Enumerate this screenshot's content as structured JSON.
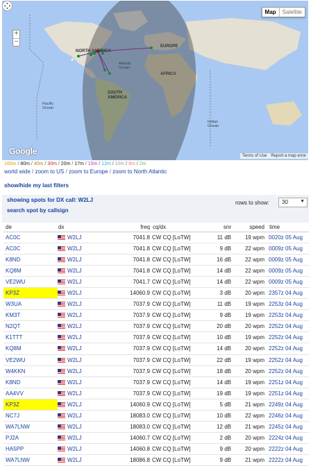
{
  "map": {
    "map_label": "Map",
    "satellite_label": "Satellite",
    "google_label": "Google",
    "terms_label": "Terms of Use",
    "report_label": "Report a map error",
    "zoom_in": "+",
    "zoom_out": "−",
    "region_labels": {
      "north_america": "NORTH\nAMERICA",
      "europe": "EUROPE",
      "africa": "AFRICA",
      "south_america": "SOUTH\nAMERICA",
      "atlantic": "Atlantic\nOcean",
      "pacific": "Pacific\nOcean",
      "indian": "Indian\nOcean"
    }
  },
  "bands": [
    {
      "label": "160m",
      "color": "#e0a000"
    },
    {
      "label": "80m",
      "color": "#222222"
    },
    {
      "label": "40m",
      "color": "#c08000"
    },
    {
      "label": "30m",
      "color": "#c03030"
    },
    {
      "label": "20m",
      "color": "#222222"
    },
    {
      "label": "17m",
      "color": "#222222"
    },
    {
      "label": "15m",
      "color": "#c030c0"
    },
    {
      "label": "12m",
      "color": "#20b0c0"
    },
    {
      "label": "10m",
      "color": "#999999"
    },
    {
      "label": "6m",
      "color": "#e08080"
    },
    {
      "label": "2m",
      "color": "#60c060"
    }
  ],
  "zoom_links": [
    "world wide",
    "zoom to US",
    "zoom to Europe",
    "zoom to North Atlantic"
  ],
  "filters_link": "show/hide my last filters",
  "panel": {
    "showing": "showing spots for DX call: W2LJ",
    "search": "search spot by callsign",
    "rows_label": "rows to show:",
    "rows_value": "30"
  },
  "table": {
    "headers": {
      "de": "de",
      "dx": "dx",
      "freq": "freq",
      "cq": "cq/dx",
      "snr": "snr",
      "speed": "speed",
      "time": "time"
    },
    "rows": [
      {
        "de": "AC0C",
        "dx": "W2LJ",
        "freq": "7041.8",
        "cq": "CW CQ [LoTW]",
        "snr": "11 dB",
        "speed": "19 wpm",
        "time": "0020z 05 Aug",
        "hl": false
      },
      {
        "de": "AC0C",
        "dx": "W2LJ",
        "freq": "7041.8",
        "cq": "CW CQ [LoTW]",
        "snr": "9 dB",
        "speed": "22 wpm",
        "time": "0009z 05 Aug",
        "hl": false
      },
      {
        "de": "K8ND",
        "dx": "W2LJ",
        "freq": "7041.8",
        "cq": "CW CQ [LoTW]",
        "snr": "16 dB",
        "speed": "22 wpm",
        "time": "0009z 05 Aug",
        "hl": false
      },
      {
        "de": "KQ8M",
        "dx": "W2LJ",
        "freq": "7041.8",
        "cq": "CW CQ [LoTW]",
        "snr": "14 dB",
        "speed": "22 wpm",
        "time": "0009z 05 Aug",
        "hl": false
      },
      {
        "de": "VE2WU",
        "dx": "W2LJ",
        "freq": "7041.7",
        "cq": "CW CQ [LoTW]",
        "snr": "14 dB",
        "speed": "22 wpm",
        "time": "0009z 05 Aug",
        "hl": false
      },
      {
        "de": "KP3Z",
        "dx": "W2LJ",
        "freq": "14060.9",
        "cq": "CW CQ [LoTW]",
        "snr": "3 dB",
        "speed": "20 wpm",
        "time": "2357z 04 Aug",
        "hl": true
      },
      {
        "de": "W3UA",
        "dx": "W2LJ",
        "freq": "7037.9",
        "cq": "CW CQ [LoTW]",
        "snr": "11 dB",
        "speed": "19 wpm",
        "time": "2253z 04 Aug",
        "hl": false
      },
      {
        "de": "KM3T",
        "dx": "W2LJ",
        "freq": "7037.9",
        "cq": "CW CQ [LoTW]",
        "snr": "9 dB",
        "speed": "19 wpm",
        "time": "2253z 04 Aug",
        "hl": false
      },
      {
        "de": "N2QT",
        "dx": "W2LJ",
        "freq": "7037.9",
        "cq": "CW CQ [LoTW]",
        "snr": "20 dB",
        "speed": "20 wpm",
        "time": "2252z 04 Aug",
        "hl": false
      },
      {
        "de": "K1TTT",
        "dx": "W2LJ",
        "freq": "7037.9",
        "cq": "CW CQ [LoTW]",
        "snr": "10 dB",
        "speed": "19 wpm",
        "time": "2252z 04 Aug",
        "hl": false
      },
      {
        "de": "KQ8M",
        "dx": "W2LJ",
        "freq": "7037.9",
        "cq": "CW CQ [LoTW]",
        "snr": "14 dB",
        "speed": "20 wpm",
        "time": "2252z 04 Aug",
        "hl": false
      },
      {
        "de": "VE2WU",
        "dx": "W2LJ",
        "freq": "7037.9",
        "cq": "CW CQ [LoTW]",
        "snr": "22 dB",
        "speed": "19 wpm",
        "time": "2252z 04 Aug",
        "hl": false
      },
      {
        "de": "W4KKN",
        "dx": "W2LJ",
        "freq": "7037.9",
        "cq": "CW CQ [LoTW]",
        "snr": "18 dB",
        "speed": "20 wpm",
        "time": "2252z 04 Aug",
        "hl": false
      },
      {
        "de": "K8ND",
        "dx": "W2LJ",
        "freq": "7037.9",
        "cq": "CW CQ [LoTW]",
        "snr": "14 dB",
        "speed": "19 wpm",
        "time": "2251z 04 Aug",
        "hl": false
      },
      {
        "de": "AA4VV",
        "dx": "W2LJ",
        "freq": "7037.9",
        "cq": "CW CQ [LoTW]",
        "snr": "19 dB",
        "speed": "19 wpm",
        "time": "2251z 04 Aug",
        "hl": false
      },
      {
        "de": "KP3Z",
        "dx": "W2LJ",
        "freq": "14060.9",
        "cq": "CW CQ [LoTW]",
        "snr": "5 dB",
        "speed": "21 wpm",
        "time": "2249z 04 Aug",
        "hl": true
      },
      {
        "de": "NC7J",
        "dx": "W2LJ",
        "freq": "18083.0",
        "cq": "CW CQ [LoTW]",
        "snr": "10 dB",
        "speed": "22 wpm",
        "time": "2246z 04 Aug",
        "hl": false
      },
      {
        "de": "WA7LNW",
        "dx": "W2LJ",
        "freq": "18083.0",
        "cq": "CW CQ [LoTW]",
        "snr": "12 dB",
        "speed": "21 wpm",
        "time": "2245z 04 Aug",
        "hl": false
      },
      {
        "de": "PJ2A",
        "dx": "W2LJ",
        "freq": "14060.7",
        "cq": "CW CQ [LoTW]",
        "snr": "2 dB",
        "speed": "20 wpm",
        "time": "2224z 04 Aug",
        "hl": false
      },
      {
        "de": "HA5PP",
        "dx": "W2LJ",
        "freq": "14060.8",
        "cq": "CW CQ [LoTW]",
        "snr": "9 dB",
        "speed": "20 wpm",
        "time": "2222z 04 Aug",
        "hl": false
      },
      {
        "de": "WA7LNW",
        "dx": "W2LJ",
        "freq": "18086.8",
        "cq": "CW CQ [LoTW]",
        "snr": "9 dB",
        "speed": "21 wpm",
        "time": "2222z 04 Aug",
        "hl": false
      }
    ]
  }
}
